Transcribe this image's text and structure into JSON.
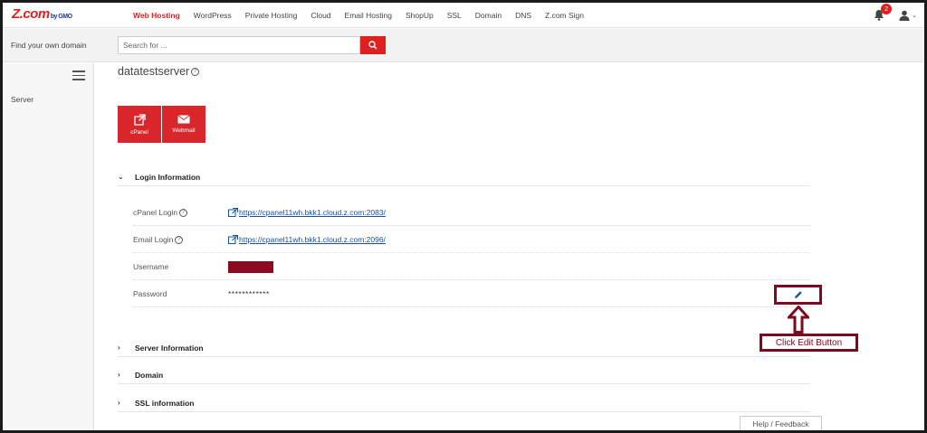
{
  "brand": {
    "name": "Z.com",
    "suffix": "by GMO"
  },
  "nav": {
    "items": [
      "Web Hosting",
      "WordPress",
      "Private Hosting",
      "Cloud",
      "Email Hosting",
      "ShopUp",
      "SSL",
      "Domain",
      "DNS",
      "Z.com Sign"
    ],
    "active": "Web Hosting"
  },
  "notifications": {
    "count": "2"
  },
  "search": {
    "label": "Find your own domain",
    "placeholder": "Search for ..."
  },
  "sidebar": {
    "items": [
      "Server"
    ]
  },
  "page": {
    "title": "datatestserver"
  },
  "tiles": [
    {
      "label": "cPanel",
      "icon": "external-link-icon"
    },
    {
      "label": "Webmail",
      "icon": "envelope-icon"
    }
  ],
  "sections": {
    "login": {
      "title": "Login Information",
      "state": "expanded"
    },
    "server": {
      "title": "Server Information",
      "state": "collapsed"
    },
    "domain": {
      "title": "Domain",
      "state": "collapsed"
    },
    "ssl": {
      "title": "SSL information",
      "state": "collapsed"
    }
  },
  "login_info": {
    "cpanel": {
      "label": "cPanel Login",
      "url": "https://cpanel11wh.bkk1.cloud.z.com:2083/"
    },
    "email": {
      "label": "Email Login",
      "url": "https://cpanel11wh.bkk1.cloud.z.com:2096/"
    },
    "username": {
      "label": "Username"
    },
    "password": {
      "label": "Password",
      "value": "************"
    }
  },
  "annotation": {
    "text": "Click Edit Button"
  },
  "footer": {
    "help": "Help / Feedback"
  },
  "colors": {
    "brand_red": "#e02020",
    "tile_red": "#d9262a",
    "annotation": "#7d0a1e",
    "link": "#1a4fa0"
  }
}
